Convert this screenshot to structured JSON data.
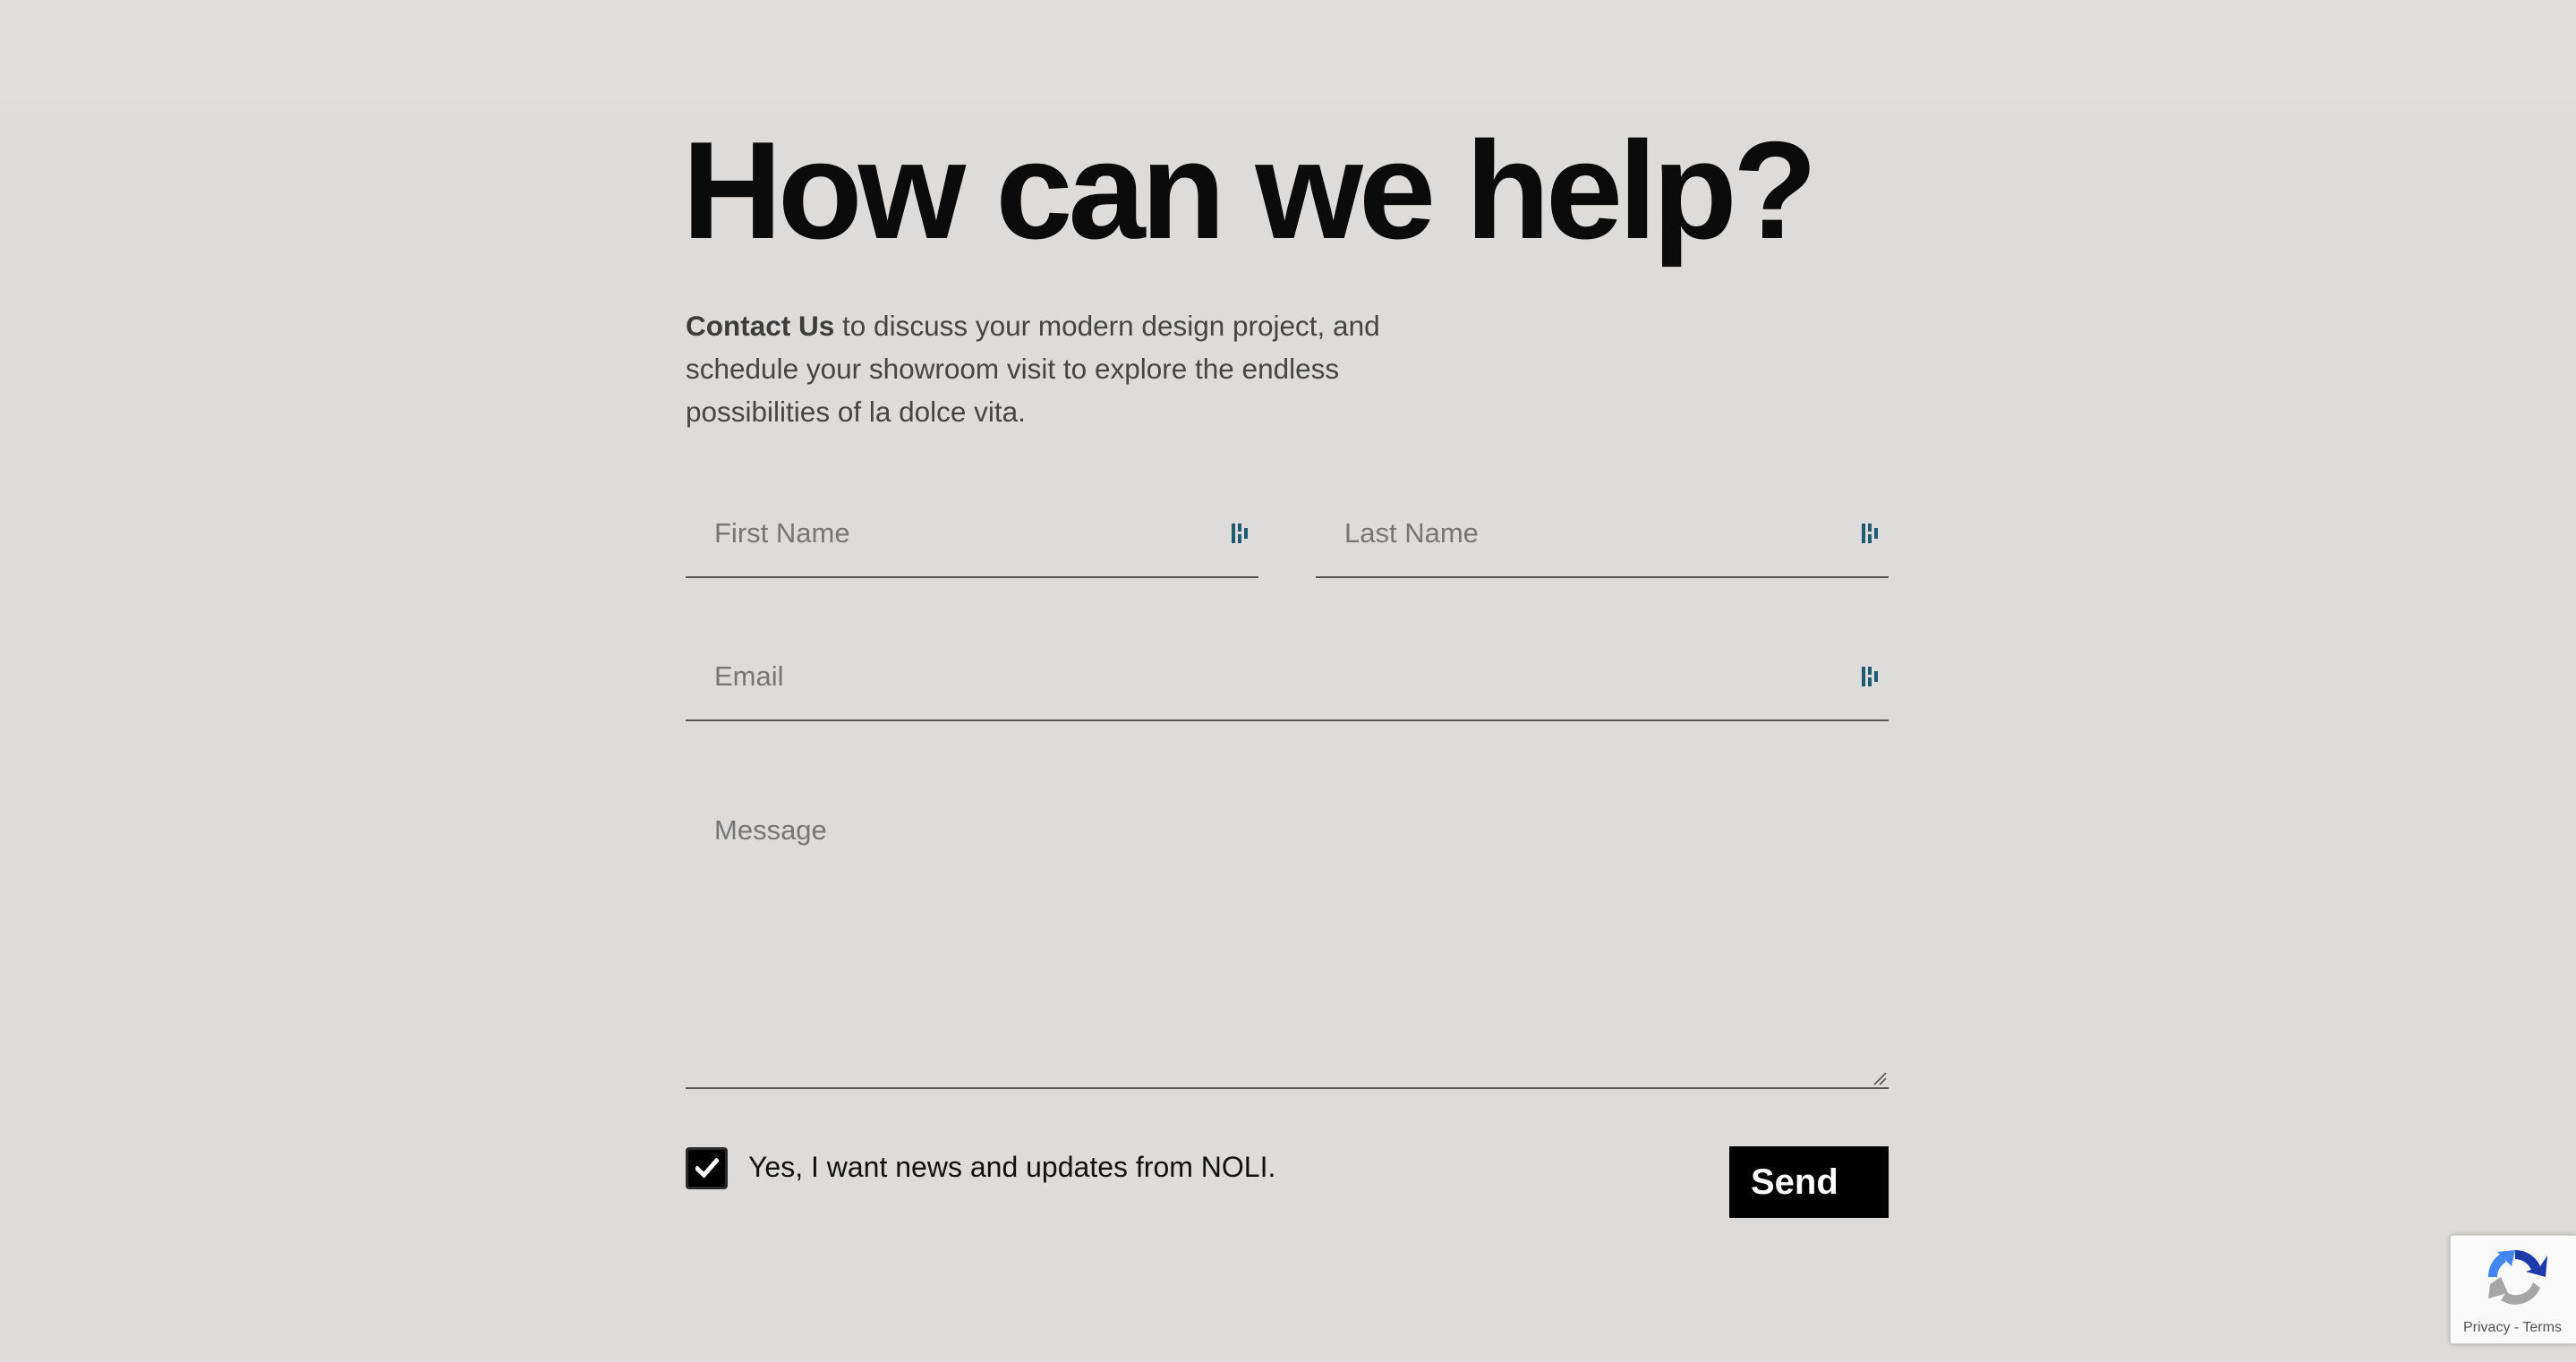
{
  "heading": "How can we help?",
  "intro": {
    "bold": "Contact Us",
    "rest": " to discuss your modern design project, and schedule your showroom visit to explore the endless possibilities of la dolce vita."
  },
  "form": {
    "first_name_placeholder": "First Name",
    "last_name_placeholder": "Last Name",
    "email_placeholder": "Email",
    "message_placeholder": "Message",
    "field_icon": "password-manager-icon",
    "newsletter": {
      "checked": true,
      "label": "Yes, I want news and updates from NOLI."
    },
    "send_label": "Send"
  },
  "recaptcha": {
    "icon": "recaptcha-icon",
    "privacy": "Privacy",
    "separator": " - ",
    "terms": "Terms"
  },
  "colors": {
    "background": "#dddcdb",
    "text": "#0b0b0b",
    "button": "#000000",
    "icon_accent": "#1f5a73"
  }
}
